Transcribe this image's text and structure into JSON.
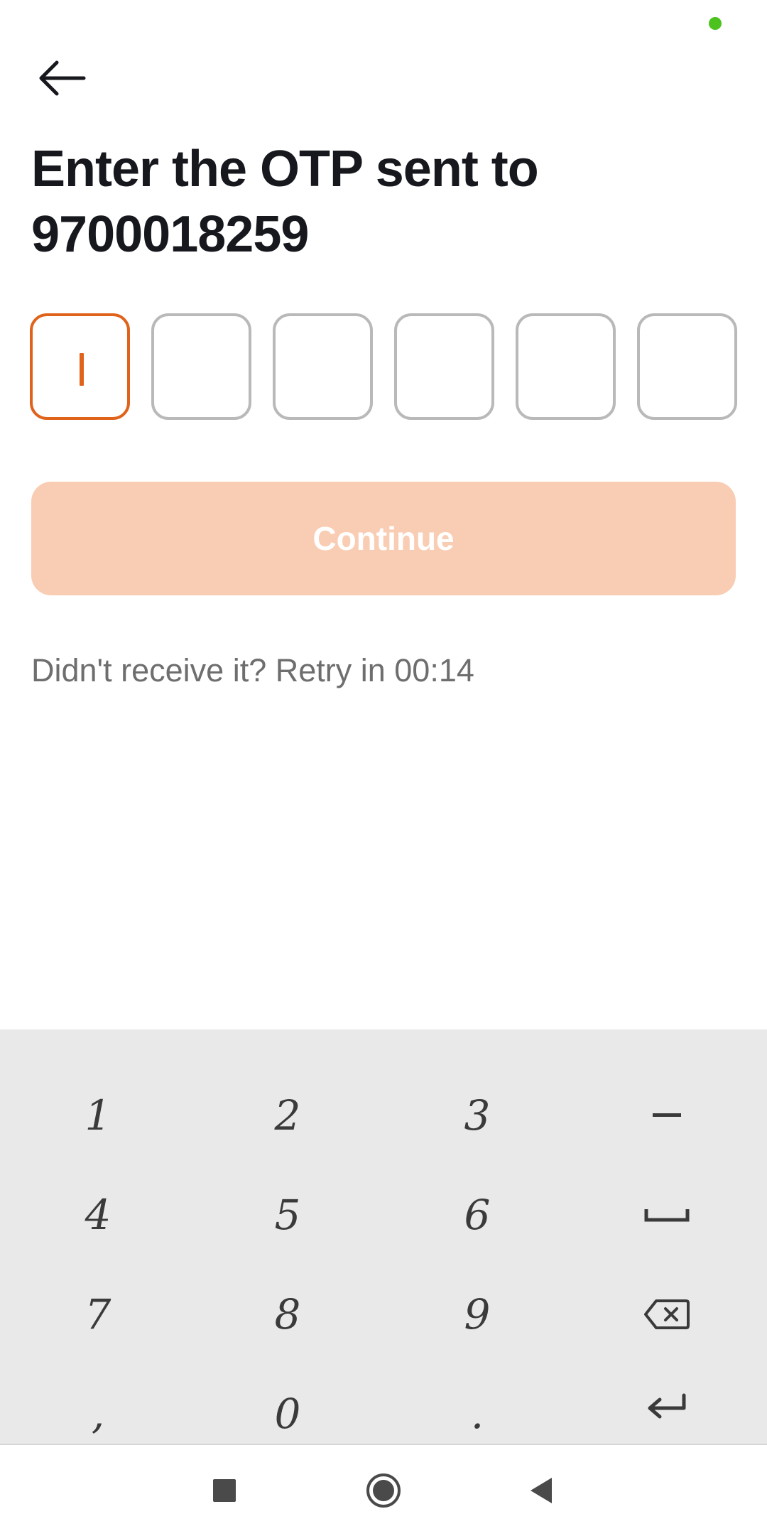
{
  "header": {
    "title_line1": "Enter the OTP sent to",
    "title_line2": "9700018259"
  },
  "otp": {
    "digits": [
      "",
      "",
      "",
      "",
      "",
      ""
    ],
    "active_index": 0
  },
  "continue_label": "Continue",
  "retry_text": "Didn't receive it? Retry in 00:14",
  "keyboard": {
    "keys": [
      {
        "label": "1",
        "type": "digit"
      },
      {
        "label": "2",
        "type": "digit"
      },
      {
        "label": "3",
        "type": "digit"
      },
      {
        "label": "−",
        "type": "minus-icon"
      },
      {
        "label": "4",
        "type": "digit"
      },
      {
        "label": "5",
        "type": "digit"
      },
      {
        "label": "6",
        "type": "digit"
      },
      {
        "label": "",
        "type": "space-icon"
      },
      {
        "label": "7",
        "type": "digit"
      },
      {
        "label": "8",
        "type": "digit"
      },
      {
        "label": "9",
        "type": "digit"
      },
      {
        "label": "",
        "type": "backspace-icon"
      },
      {
        "label": ",",
        "type": "digit"
      },
      {
        "label": "0",
        "type": "digit"
      },
      {
        "label": ".",
        "type": "digit"
      },
      {
        "label": "",
        "type": "enter-icon"
      }
    ]
  },
  "colors": {
    "accent": "#e0631c",
    "button_disabled": "#f9cdb3",
    "status_dot": "#4cc21f",
    "keyboard_bg": "#e9e9e9"
  },
  "icons": [
    "back-arrow-icon",
    "status-dot-icon",
    "minus-icon",
    "space-icon",
    "backspace-icon",
    "enter-icon",
    "recents-icon",
    "home-icon",
    "back-triangle-icon"
  ]
}
